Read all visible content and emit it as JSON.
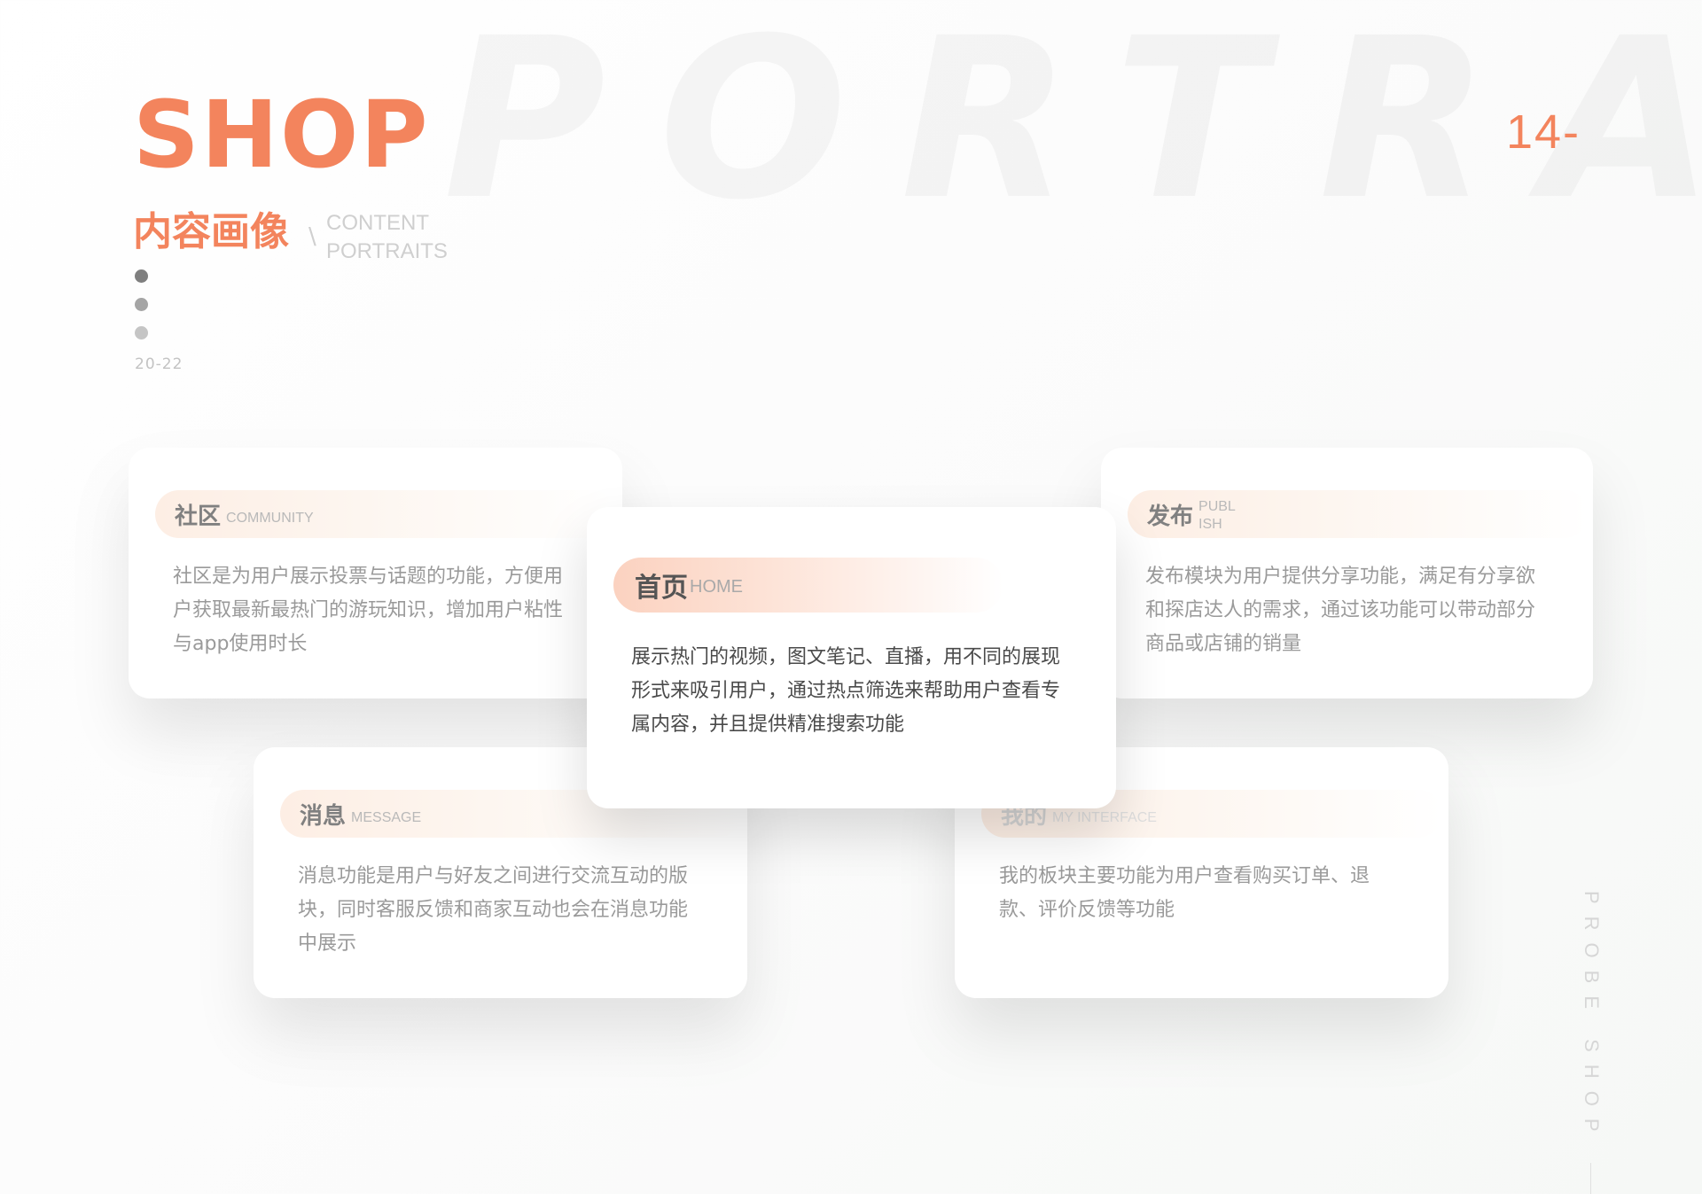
{
  "watermark": "PORTRAIT",
  "header": {
    "title": "SHOP",
    "subtitle_cn": "内容画像",
    "separator": "\\",
    "subtitle_en_line1": "CONTENT",
    "subtitle_en_line2": "PORTRAITS",
    "range": "20-22",
    "page_number": "14-"
  },
  "side_label": "PROBE SHOP",
  "colors": {
    "accent": "#f3845d",
    "text_gray": "#9a9a9a",
    "text_dark": "#4a4a4a"
  },
  "cards": {
    "community": {
      "title": "社区",
      "subtitle": "COMMUNITY",
      "text": "社区是为用户展示投票与话题的功能，方便用户获取最新最热门的游玩知识，增加用户粘性与app使用时长"
    },
    "home": {
      "title": "首页",
      "subtitle": "HOME",
      "text": "展示热门的视频，图文笔记、直播，用不同的展现形式来吸引用户，通过热点筛选来帮助用户查看专属内容，并且提供精准搜索功能"
    },
    "publish": {
      "title": "发布",
      "subtitle": "PUBL ISH",
      "text": "发布模块为用户提供分享功能，满足有分享欲和探店达人的需求，通过该功能可以带动部分商品或店铺的销量"
    },
    "message": {
      "title": "消息",
      "subtitle": "MESSAGE",
      "text": "消息功能是用户与好友之间进行交流互动的版块，同时客服反馈和商家互动也会在消息功能中展示"
    },
    "mine": {
      "title": "我的",
      "subtitle": "MY INTERFACE",
      "text": "我的板块主要功能为用户查看购买订单、退款、评价反馈等功能"
    }
  }
}
